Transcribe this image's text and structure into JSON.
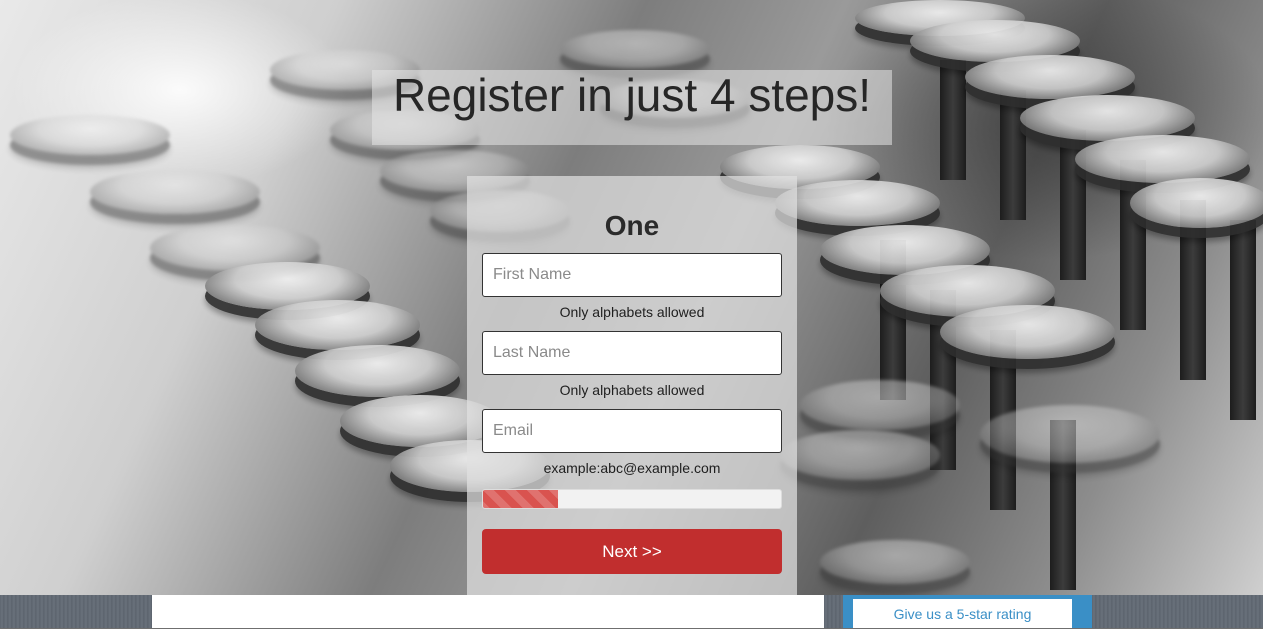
{
  "header": {
    "title": "Register in just 4 steps!"
  },
  "form": {
    "step_heading": "One",
    "first_name": {
      "placeholder": "First Name",
      "value": "",
      "hint": "Only alphabets allowed"
    },
    "last_name": {
      "placeholder": "Last Name",
      "value": "",
      "hint": "Only alphabets allowed"
    },
    "email": {
      "placeholder": "Email",
      "value": "",
      "hint": "example:abc@example.com"
    },
    "progress": {
      "percent": 25
    },
    "next_label": "Next >>"
  },
  "footer": {
    "rating_label": "Give us a 5-star rating"
  },
  "colors": {
    "accent_red": "#c12e2e",
    "progress_red": "#d9534f",
    "rating_blue": "#3a8fc6"
  }
}
